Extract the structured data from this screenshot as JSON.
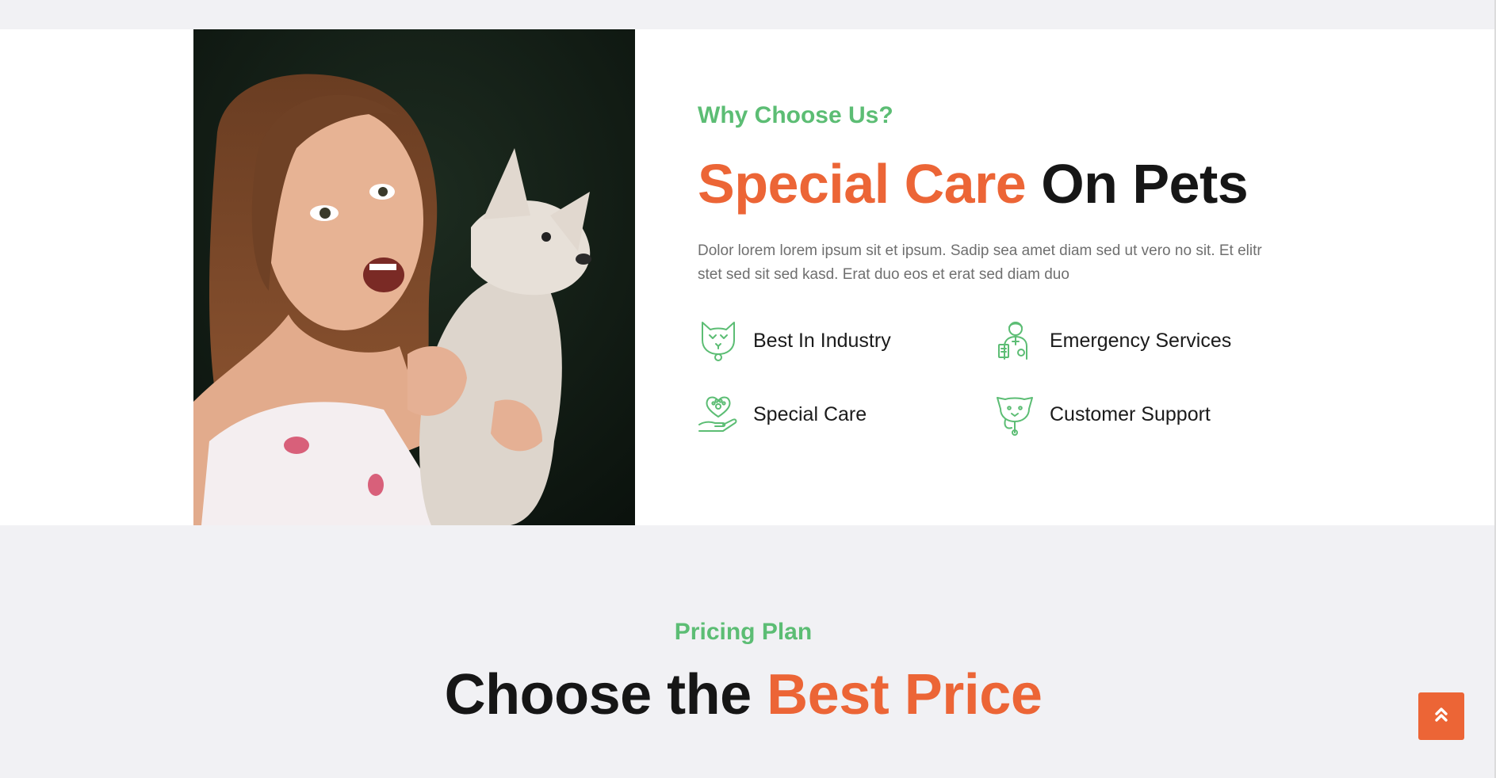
{
  "why": {
    "eyebrow": "Why Choose Us?",
    "headline_accent": "Special Care",
    "headline_rest": "On Pets",
    "description": "Dolor lorem lorem ipsum sit et ipsum. Sadip sea amet diam sed ut vero no sit. Et elitr stet sed sit sed kasd. Erat duo eos et erat sed diam duo",
    "features": [
      {
        "label": "Best In Industry",
        "icon": "cat-face-icon"
      },
      {
        "label": "Emergency Services",
        "icon": "vet-doctor-icon"
      },
      {
        "label": "Special Care",
        "icon": "heart-paw-hand-icon"
      },
      {
        "label": "Customer Support",
        "icon": "dog-stethoscope-icon"
      }
    ]
  },
  "pricing": {
    "eyebrow": "Pricing Plan",
    "title_plain": "Choose the",
    "title_accent": "Best Price"
  },
  "colors": {
    "accent_orange": "#ec6536",
    "accent_green": "#5cbd74",
    "heading": "#161616",
    "body_text": "#6f6f6f",
    "section_bg": "#f1f1f4"
  },
  "back_to_top": {
    "icon": "double-chevron-up-icon"
  }
}
